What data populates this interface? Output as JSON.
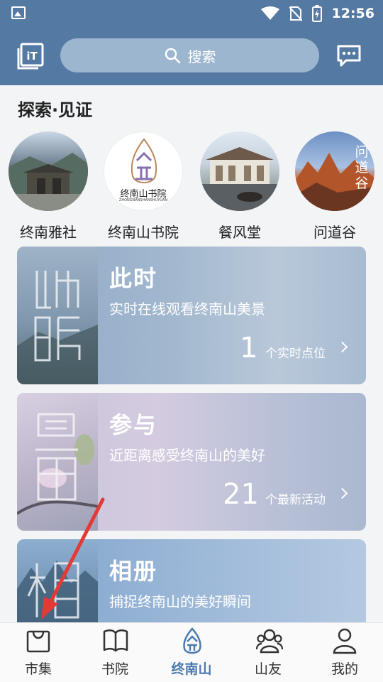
{
  "status_bar": {
    "time": "12:56"
  },
  "header": {
    "search_placeholder": "搜索"
  },
  "explore": {
    "title": "探索·见证",
    "places": [
      {
        "name": "终南雅社",
        "icon": "temple-photo"
      },
      {
        "name": "终南山书院",
        "icon": "academy-logo",
        "logo_text": "终南山书院",
        "logo_sub": "ZHONGNANSHANSHUYUAN"
      },
      {
        "name": "餐风堂",
        "icon": "hall-photo"
      },
      {
        "name": "问道谷",
        "icon": "valley-photo",
        "overlay_text": "问道谷"
      }
    ]
  },
  "cards": [
    {
      "title": "此时",
      "subtitle": "实时在线观看终南山美景",
      "count": "1",
      "unit": "个实时点位"
    },
    {
      "title": "参与",
      "subtitle": "近距离感受终南山的美好",
      "count": "21",
      "unit": "个最新活动"
    },
    {
      "title": "相册",
      "subtitle": "捕捉终南山的美好瞬间"
    }
  ],
  "tabs": [
    {
      "label": "市集",
      "icon": "bag-icon"
    },
    {
      "label": "书院",
      "icon": "book-icon"
    },
    {
      "label": "终南山",
      "icon": "mountain-logo-icon",
      "active": true
    },
    {
      "label": "山友",
      "icon": "friends-icon"
    },
    {
      "label": "我的",
      "icon": "person-icon"
    }
  ],
  "colors": {
    "primary": "#5479a3",
    "active_tab": "#4a7bb0",
    "annotation_arrow": "#e53935"
  }
}
